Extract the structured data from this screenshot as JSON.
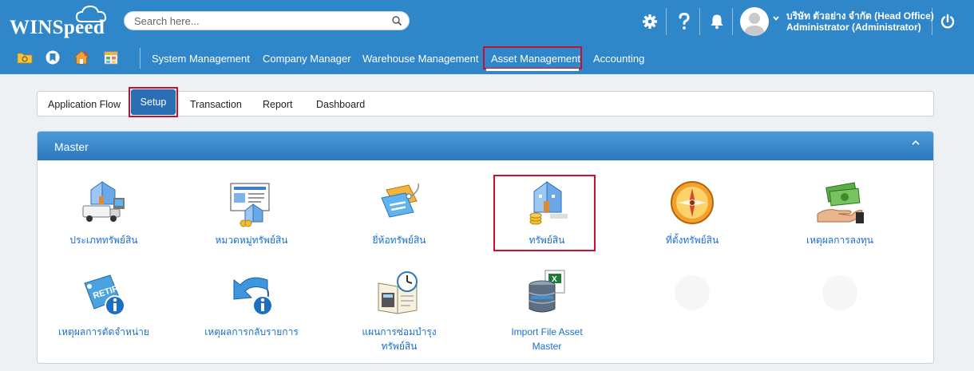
{
  "header": {
    "logo_text": "WINSpeed",
    "search_placeholder": "Search here...",
    "company": "บริษัท ตัวอย่าง จำกัด (Head Office)",
    "user": "Administrator (Administrator)",
    "icons": [
      "gear-icon",
      "help-icon",
      "bell-icon",
      "avatar",
      "chevron-down-icon",
      "power-icon"
    ]
  },
  "quick_icons": [
    "folder-icon",
    "bookmark-icon",
    "home-icon",
    "calendar-grid-icon"
  ],
  "nav": {
    "items": [
      "System Management",
      "Company Manager",
      "Warehouse Management",
      "Asset Management",
      "Accounting"
    ],
    "active": "Asset Management"
  },
  "subtabs": {
    "items": [
      "Application Flow",
      "Setup",
      "Transaction",
      "Report",
      "Dashboard"
    ],
    "active": "Setup"
  },
  "panel": {
    "title": "Master",
    "tiles": [
      {
        "label": "ประเภททรัพย์สิน",
        "icon": "asset-type-icon"
      },
      {
        "label": "หมวดหมู่ทรัพย์สิน",
        "icon": "asset-category-icon"
      },
      {
        "label": "ยี่ห้อทรัพย์สิน",
        "icon": "asset-brand-tag-icon"
      },
      {
        "label": "ทรัพย์สิน",
        "icon": "asset-building-coins-icon"
      },
      {
        "label": "ที่ตั้งทรัพย์สิน",
        "icon": "compass-location-icon"
      },
      {
        "label": "เหตุผลการลงทุน",
        "icon": "money-hand-icon"
      },
      {
        "label": "เหตุผลการตัดจำหน่าย",
        "icon": "retire-tag-icon"
      },
      {
        "label": "เหตุผลการกลับรายการ",
        "icon": "reverse-arrow-icon"
      },
      {
        "label_line1": "แผนการซ่อมบำรุง",
        "label_line2": "ทรัพย์สิน",
        "icon": "maintenance-plan-icon"
      },
      {
        "label_line1": "Import File Asset",
        "label_line2": "Master",
        "icon": "import-excel-database-icon"
      }
    ]
  },
  "colors": {
    "header_bg": "#2f87c9",
    "panel_head": "#2b78be",
    "highlight": "#c8102e",
    "link": "#1a6fcc",
    "active_tab": "#2a6fb5"
  }
}
